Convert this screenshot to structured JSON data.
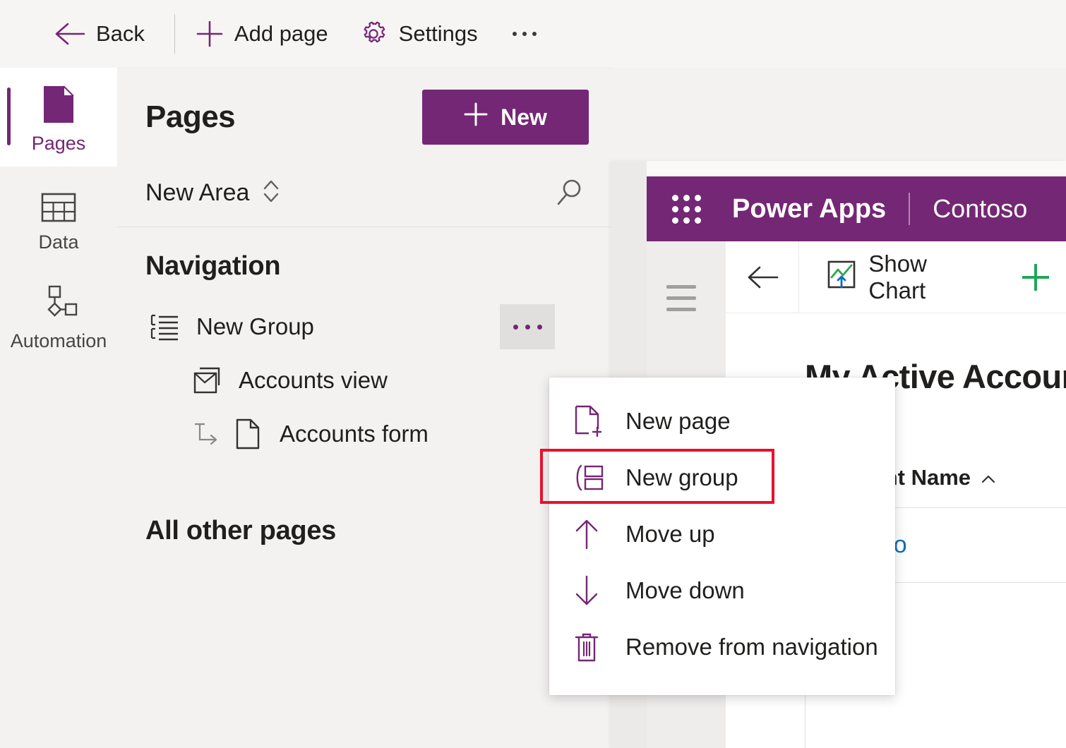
{
  "topbar": {
    "back_label": "Back",
    "add_page_label": "Add page",
    "settings_label": "Settings",
    "overflow_label": "More commands",
    "back_icon": "arrow-left-icon",
    "add_icon": "plus-icon",
    "settings_icon": "gear-icon",
    "overflow_icon": "ellipsis-icon"
  },
  "rail": {
    "items": [
      {
        "label": "Pages",
        "icon": "page-icon",
        "active": true
      },
      {
        "label": "Data",
        "icon": "table-icon",
        "active": false
      },
      {
        "label": "Automation",
        "icon": "flow-icon",
        "active": false
      }
    ]
  },
  "pages_panel": {
    "title": "Pages",
    "new_button_label": "New",
    "new_button_icon": "plus-icon",
    "area_name": "New Area",
    "area_switch_icon": "chevron-updown-icon",
    "search_icon": "search-icon",
    "navigation_title": "Navigation",
    "nav_items": [
      {
        "label": "New Group",
        "icon": "group-list-icon",
        "level": "group",
        "has_more": true,
        "more_icon": "ellipsis-icon"
      },
      {
        "label": "Accounts view",
        "icon": "view-icon",
        "level": "view",
        "has_more": false
      },
      {
        "label": "Accounts form",
        "icon": "form-page-icon",
        "level": "form",
        "branch_icon": "branch-arrow-icon",
        "has_more": false
      }
    ],
    "other_pages_title": "All other pages"
  },
  "context_menu": {
    "items": [
      {
        "label": "New page",
        "icon": "new-page-icon"
      },
      {
        "label": "New group",
        "icon": "new-group-icon",
        "highlighted": true
      },
      {
        "label": "Move up",
        "icon": "arrow-up-icon"
      },
      {
        "label": "Move down",
        "icon": "arrow-down-icon"
      },
      {
        "label": "Remove from navigation",
        "icon": "trash-icon"
      }
    ]
  },
  "preview": {
    "waffle_icon": "app-launcher-icon",
    "brand": "Power Apps",
    "environment": "Contoso",
    "hamburger_icon": "hamburger-icon",
    "home_icon": "home-icon",
    "back_icon": "arrow-left-icon",
    "show_chart_label": "Show Chart",
    "show_chart_icon": "chart-icon",
    "new_record_icon": "plus-icon",
    "view_title": "My Active Accounts",
    "grid": {
      "columns": [
        {
          "label": "Account Name",
          "sort_icon": "chevron-up-icon"
        }
      ],
      "rows": [
        {
          "account_name": "Contoso"
        }
      ]
    }
  },
  "colors": {
    "brand_purple": "#742774",
    "accent_green": "#22a558",
    "link_blue": "#0f6cbd",
    "annotation_red": "#e8112d",
    "panel_bg": "#f3f2f1",
    "topbar_bg": "#f6f5f4"
  }
}
